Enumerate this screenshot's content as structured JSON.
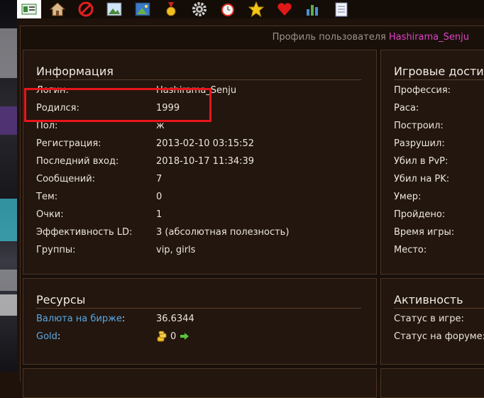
{
  "toolbar": {
    "icons": [
      "profile-card-icon",
      "home-icon",
      "ban-icon",
      "image-icon",
      "picture-icon",
      "medal-icon",
      "gear-icon",
      "alarm-clock-icon",
      "star-icon",
      "heart-icon",
      "chart-icon",
      "notepad-icon"
    ]
  },
  "header": {
    "label": "Профиль пользователя",
    "username": "Hashirama_Senju"
  },
  "info": {
    "title": "Информация",
    "rows": [
      {
        "k": "Логин:",
        "v": "Hashirama_Senju"
      },
      {
        "k": "Родился:",
        "v": "1999"
      },
      {
        "k": "Пол:",
        "v": "ж"
      },
      {
        "k": "Регистрация:",
        "v": "2013-02-10 03:15:52"
      },
      {
        "k": "Последний вход:",
        "v": "2018-10-17 11:34:39"
      },
      {
        "k": "Сообщений:",
        "v": "7"
      },
      {
        "k": "Тем:",
        "v": "0"
      },
      {
        "k": "Очки:",
        "v": "1"
      },
      {
        "k": "Эффективность LD:",
        "v": "3",
        "v2": " (абсолютная полезность)"
      },
      {
        "k": "Группы:",
        "v": "vip",
        "sep": ", ",
        "v2": "girls"
      }
    ]
  },
  "game": {
    "title": "Игровые достиж",
    "rows": [
      "Профессия:",
      "Раса:",
      "Построил:",
      "Разрушил:",
      "Убил в PvP:",
      "Убил на PK:",
      "Умер:",
      "Пройдено:",
      "Время игры:",
      "Место:"
    ]
  },
  "resources": {
    "title": "Ресурсы",
    "currency_label": "Валюта на бирже",
    "currency_colon": ":",
    "currency_value": "36.6344",
    "gold_label": "Gold",
    "gold_colon": ":",
    "gold_value": "0"
  },
  "activity": {
    "title": "Активность",
    "rows": [
      "Статус в игре:",
      "Статус на форуме:"
    ]
  },
  "colors": {
    "accent_pink": "#f048d0",
    "green": "#6fe06f",
    "link": "#5aa9e6",
    "highlight": "#e8151b"
  }
}
